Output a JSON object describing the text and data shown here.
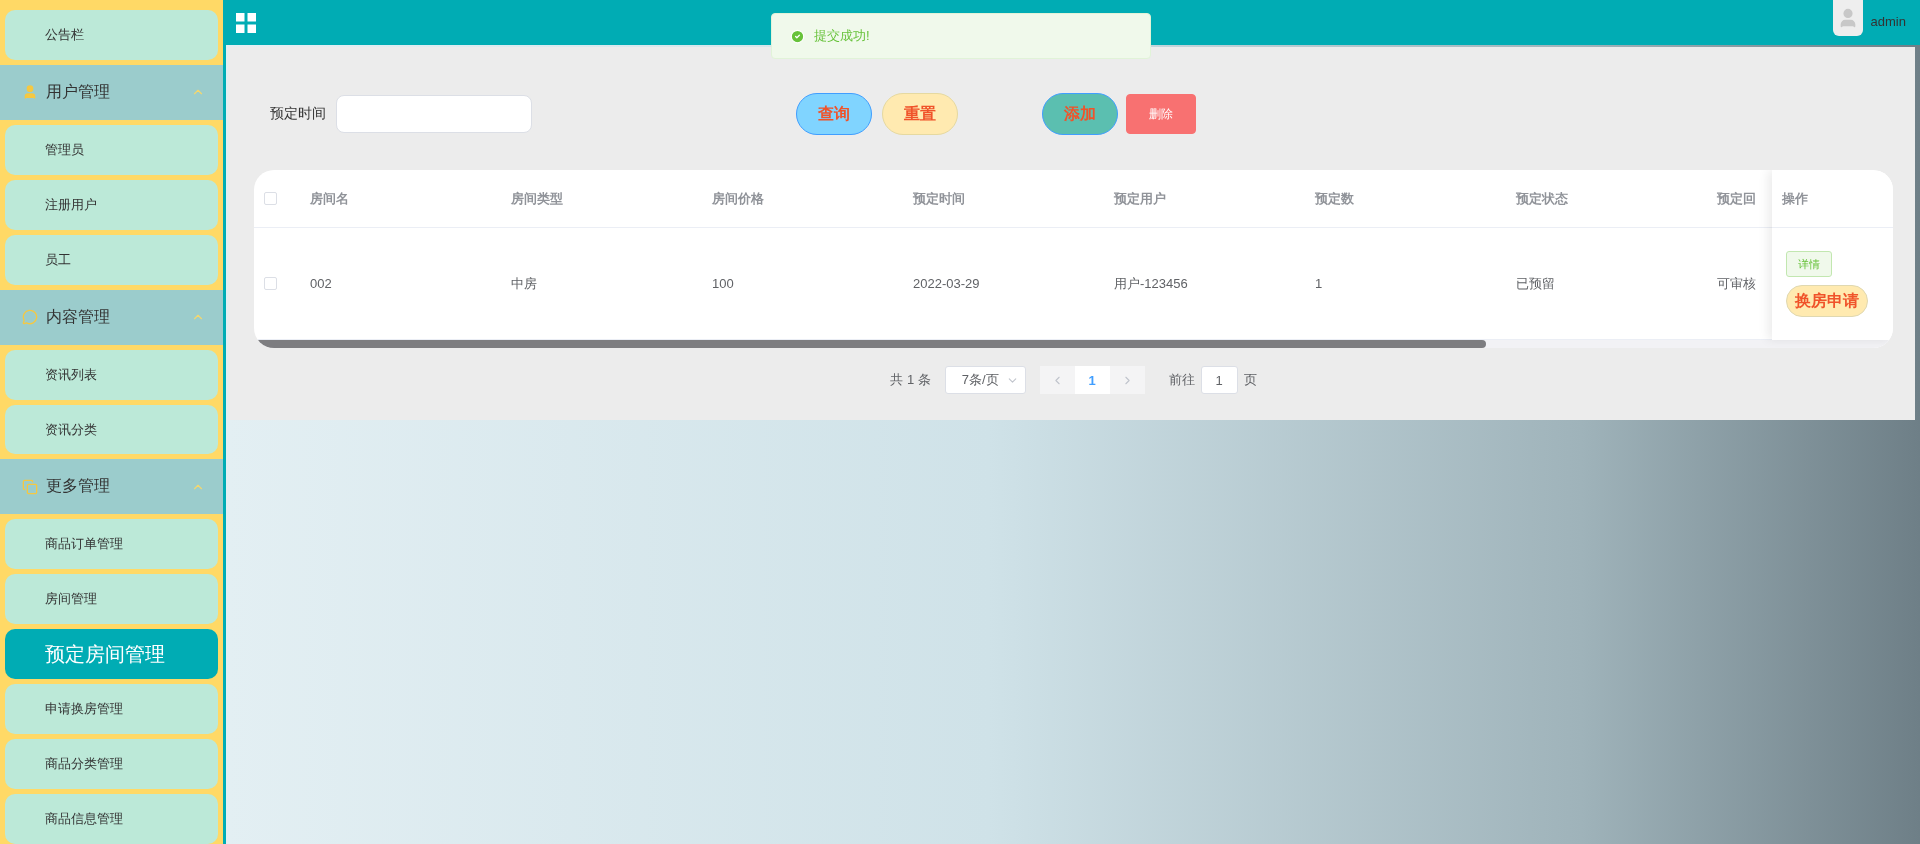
{
  "sidebar": {
    "items": [
      {
        "label": "公告栏",
        "selected": false
      }
    ],
    "groups": [
      {
        "label": "用户管理",
        "expanded": true,
        "items": [
          {
            "label": "管理员",
            "selected": false
          },
          {
            "label": "注册用户",
            "selected": false
          },
          {
            "label": "员工",
            "selected": false
          }
        ]
      },
      {
        "label": "内容管理",
        "expanded": true,
        "items": [
          {
            "label": "资讯列表",
            "selected": false
          },
          {
            "label": "资讯分类",
            "selected": false
          }
        ]
      },
      {
        "label": "更多管理",
        "expanded": true,
        "items": [
          {
            "label": "商品订单管理",
            "selected": false
          },
          {
            "label": "房间管理",
            "selected": false
          },
          {
            "label": "预定房间管理",
            "selected": true
          },
          {
            "label": "申请换房管理",
            "selected": false
          },
          {
            "label": "商品分类管理",
            "selected": false
          },
          {
            "label": "商品信息管理",
            "selected": false
          }
        ]
      }
    ]
  },
  "header": {
    "user": "admin"
  },
  "toast": {
    "message": "提交成功!"
  },
  "filter": {
    "label": "预定时间"
  },
  "buttons": [
    {
      "kind": "query",
      "label": "查询"
    },
    {
      "kind": "reset",
      "label": "重置"
    },
    {
      "kind": "add",
      "label": "添加"
    },
    {
      "kind": "delete",
      "label": "删除"
    }
  ],
  "table": {
    "all_checked": false,
    "columns": [
      "房间名",
      "房间类型",
      "房间价格",
      "预定时间",
      "预定用户",
      "预定数",
      "预定状态",
      "预定回"
    ],
    "action_column": "操作",
    "rows": [
      {
        "checked": false,
        "cells": [
          "002",
          "中房",
          "100",
          "2022-03-29",
          "用户-123456",
          "1",
          "已预留",
          "可审核"
        ],
        "actions": [
          {
            "kind": "detail",
            "label": "详情"
          },
          {
            "kind": "swap",
            "label": "换房申请"
          }
        ]
      }
    ]
  },
  "pagination": {
    "total": "共 1 条",
    "page_size": "7条/页",
    "pages": [
      {
        "label": "1",
        "selected": true
      }
    ],
    "goto_label": "前往",
    "goto_value": "1",
    "goto_suffix": "页"
  }
}
